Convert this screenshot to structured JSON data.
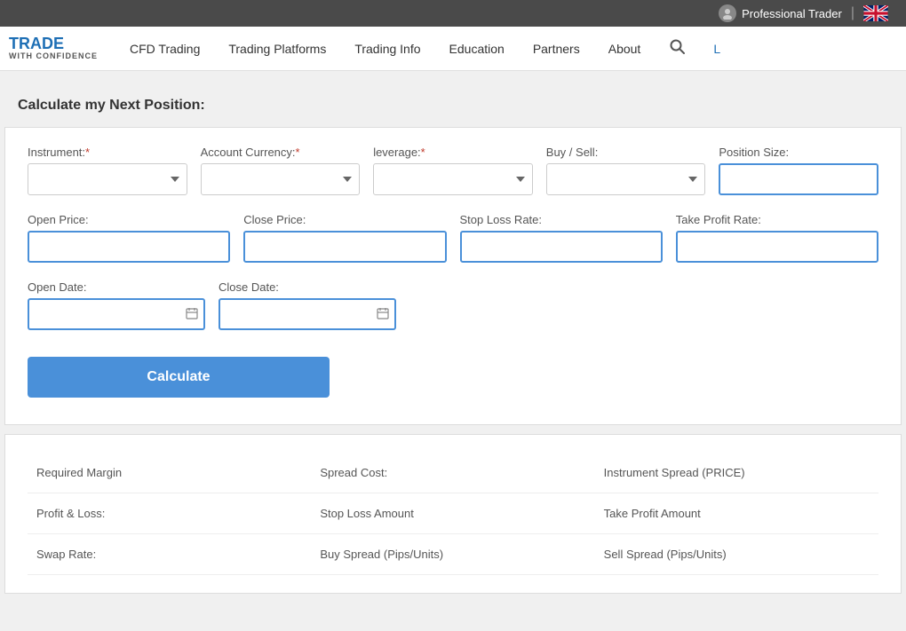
{
  "topbar": {
    "user_label": "Professional Trader",
    "divider": "|"
  },
  "nav": {
    "logo_line1": "TRADE",
    "logo_line2": "WITH CONFIDENCE",
    "items": [
      {
        "label": "CFD Trading",
        "id": "cfd-trading"
      },
      {
        "label": "Trading Platforms",
        "id": "trading-platforms"
      },
      {
        "label": "Trading Info",
        "id": "trading-info"
      },
      {
        "label": "Education",
        "id": "education"
      },
      {
        "label": "Partners",
        "id": "partners"
      },
      {
        "label": "About",
        "id": "about"
      }
    ],
    "login_label": "L"
  },
  "calculator": {
    "section_title": "Calculate my Next Position:",
    "fields": {
      "instrument_label": "Instrument:",
      "instrument_required": "*",
      "account_currency_label": "Account Currency:",
      "account_currency_required": "*",
      "leverage_label": "leverage:",
      "leverage_required": "*",
      "buy_sell_label": "Buy / Sell:",
      "position_size_label": "Position Size:",
      "open_price_label": "Open Price:",
      "close_price_label": "Close Price:",
      "stop_loss_label": "Stop Loss Rate:",
      "take_profit_label": "Take Profit Rate:",
      "open_date_label": "Open Date:",
      "close_date_label": "Close Date:"
    },
    "calculate_button": "Calculate"
  },
  "results": {
    "items": [
      {
        "label": "Required Margin",
        "col": 1
      },
      {
        "label": "Spread Cost:",
        "col": 2
      },
      {
        "label": "Instrument Spread (PRICE)",
        "col": 3
      },
      {
        "label": "Profit & Loss:",
        "col": 1
      },
      {
        "label": "Stop Loss Amount",
        "col": 2
      },
      {
        "label": "Take Profit Amount",
        "col": 3
      },
      {
        "label": "Swap Rate:",
        "col": 1
      },
      {
        "label": "Buy Spread (Pips/Units)",
        "col": 2
      },
      {
        "label": "Sell Spread (Pips/Units)",
        "col": 3
      }
    ]
  }
}
